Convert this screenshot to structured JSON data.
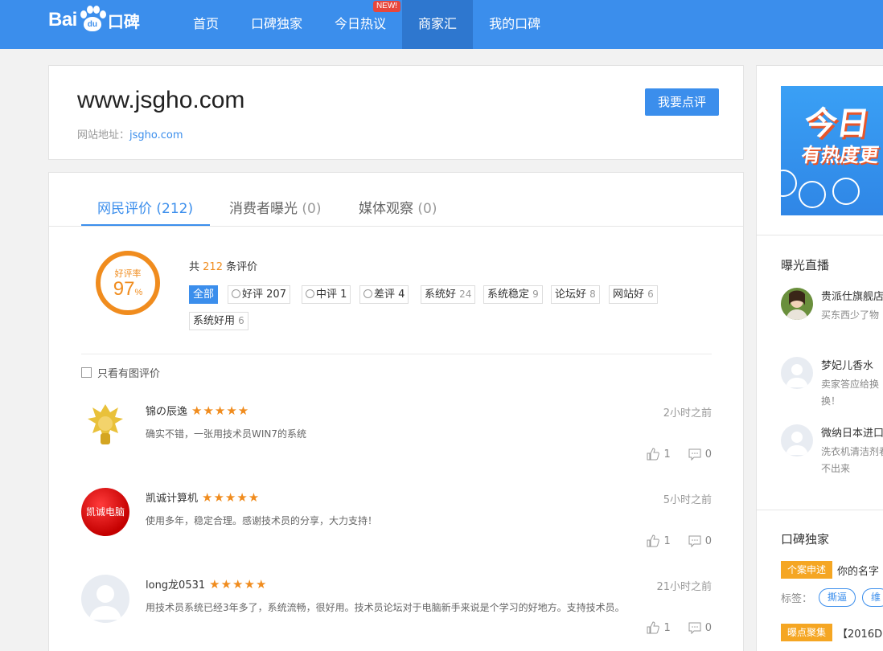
{
  "logo": {
    "bai": "Bai",
    "du": "du",
    "koubei": "口碑"
  },
  "nav": {
    "items": [
      {
        "label": "首页"
      },
      {
        "label": "口碑独家"
      },
      {
        "label": "今日热议",
        "badge": "NEW!"
      },
      {
        "label": "商家汇"
      },
      {
        "label": "我的口碑"
      }
    ],
    "active_index": 3
  },
  "site": {
    "title": "www.jsgho.com",
    "url_label": "网站地址：",
    "url": "jsgho.com",
    "review_button": "我要点评"
  },
  "tabs": [
    {
      "label": "网民评价",
      "count": "(212)"
    },
    {
      "label": "消费者曝光",
      "count": "(0)"
    },
    {
      "label": "媒体观察",
      "count": "(0)"
    }
  ],
  "rating": {
    "label": "好评率",
    "value": "97",
    "unit": "%"
  },
  "summary": {
    "prefix": "共",
    "count": "212",
    "suffix": "条评价"
  },
  "filters": [
    {
      "label": "全部",
      "count": ""
    },
    {
      "label": "好评",
      "count": "207"
    },
    {
      "label": "中评",
      "count": "1"
    },
    {
      "label": "差评",
      "count": "4"
    },
    {
      "label": "系统好",
      "count": "24"
    },
    {
      "label": "系统稳定",
      "count": "9"
    },
    {
      "label": "论坛好",
      "count": "8"
    },
    {
      "label": "网站好",
      "count": "6"
    },
    {
      "label": "系统好用",
      "count": "6"
    }
  ],
  "pic_only_label": "只看有图评价",
  "reviews": [
    {
      "name": "锦の辰逸",
      "stars": 5,
      "time": "2小时之前",
      "text": "确实不错，一张用技术员WIN7的系统",
      "likes": "1",
      "comments": "0"
    },
    {
      "name": "凯诚计算机",
      "stars": 5,
      "time": "5小时之前",
      "text": "使用多年，稳定合理。感谢技术员的分享，大力支持！",
      "likes": "1",
      "comments": "0",
      "avatar_text": "凯诚电脑"
    },
    {
      "name": "long龙0531",
      "stars": 5,
      "time": "21小时之前",
      "text": "用技术员系统已经3年多了，系统流畅，很好用。技术员论坛对于电脑新手来说是个学习的好地方。支持技术员。",
      "likes": "1",
      "comments": "0"
    }
  ],
  "sidebar": {
    "banner": {
      "line1": "今日",
      "line2": "有热度更"
    },
    "live_title": "曝光直播",
    "live": [
      {
        "name": "贵派仕旗舰店",
        "text": "买东西少了物"
      },
      {
        "name": "梦妃儿香水",
        "text": "卖家答应给换换！"
      },
      {
        "name": "微纳日本进口",
        "text": "洗衣机清洁剂看不出来"
      }
    ],
    "exclusive_title": "口碑独家",
    "tag1": {
      "badge": "个案申述",
      "text": "你的名字"
    },
    "labels_prefix": "标签：",
    "pills": [
      "撕逼",
      "维"
    ],
    "tag2": {
      "badge": "曝点聚集",
      "text": "【2016D"
    }
  },
  "colors": {
    "brand": "#3b8eec",
    "accent": "#f08c1e",
    "badge": "#f5a623"
  }
}
